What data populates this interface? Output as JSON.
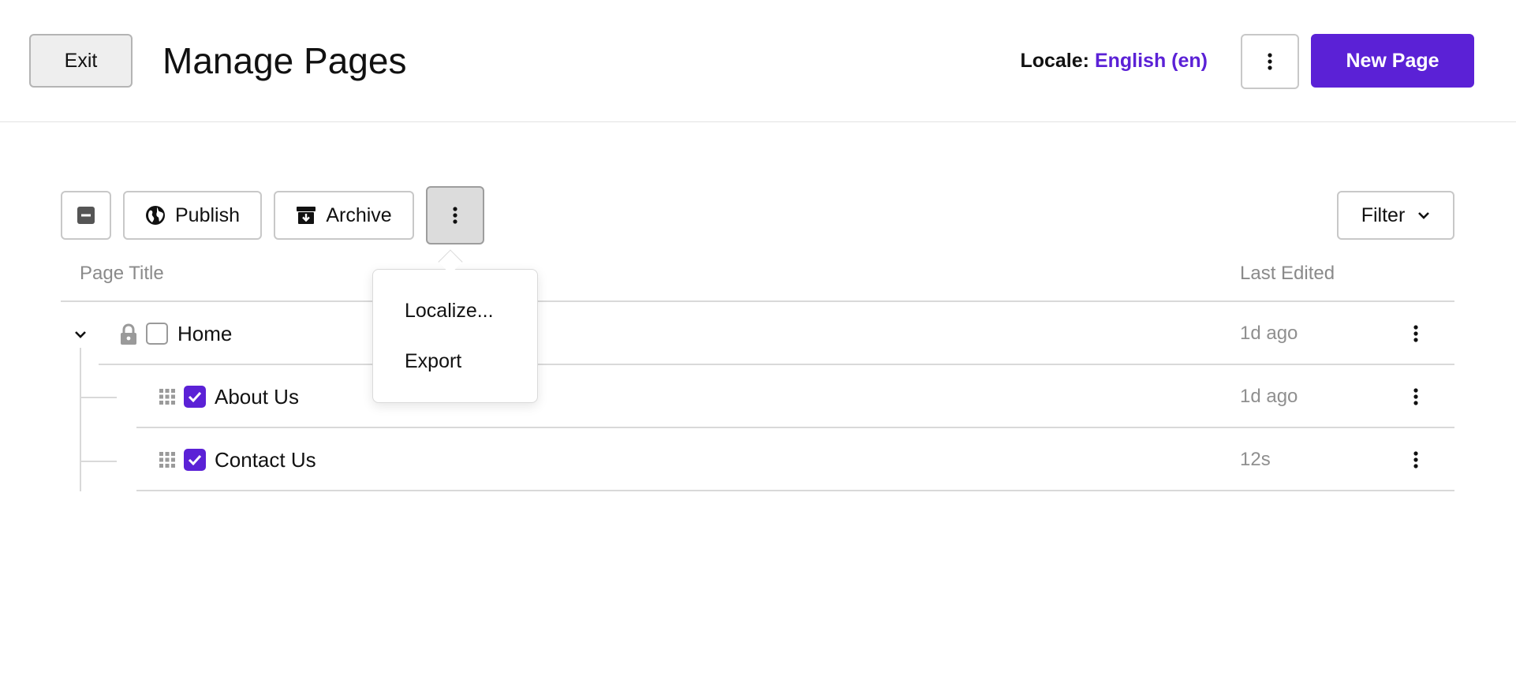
{
  "header": {
    "exit_label": "Exit",
    "title": "Manage Pages",
    "locale_label": "Locale:",
    "locale_value": "English (en)",
    "new_page_label": "New Page"
  },
  "toolbar": {
    "publish_label": "Publish",
    "archive_label": "Archive",
    "filter_label": "Filter"
  },
  "table": {
    "col_title": "Page Title",
    "col_edited": "Last Edited",
    "rows": [
      {
        "title": "Home",
        "edited": "1d ago",
        "checked": false,
        "locked": true
      },
      {
        "title": "About Us",
        "edited": "1d ago",
        "checked": true
      },
      {
        "title": "Contact Us",
        "edited": "12s",
        "checked": true
      }
    ]
  },
  "menu": {
    "items": [
      "Localize...",
      "Export"
    ]
  },
  "colors": {
    "accent": "#5b21d6",
    "muted_text": "#8a8a8a",
    "border": "#c8c8c8"
  },
  "icons": {
    "select_all": "minus-square-icon",
    "publish": "globe-icon",
    "archive": "archive-box-icon",
    "more": "vertical-ellipsis-icon",
    "filter": "chevron-down-icon",
    "expand": "chevron-down-icon",
    "locked": "lock-icon",
    "drag": "drag-grid-icon",
    "checked": "check-icon"
  }
}
